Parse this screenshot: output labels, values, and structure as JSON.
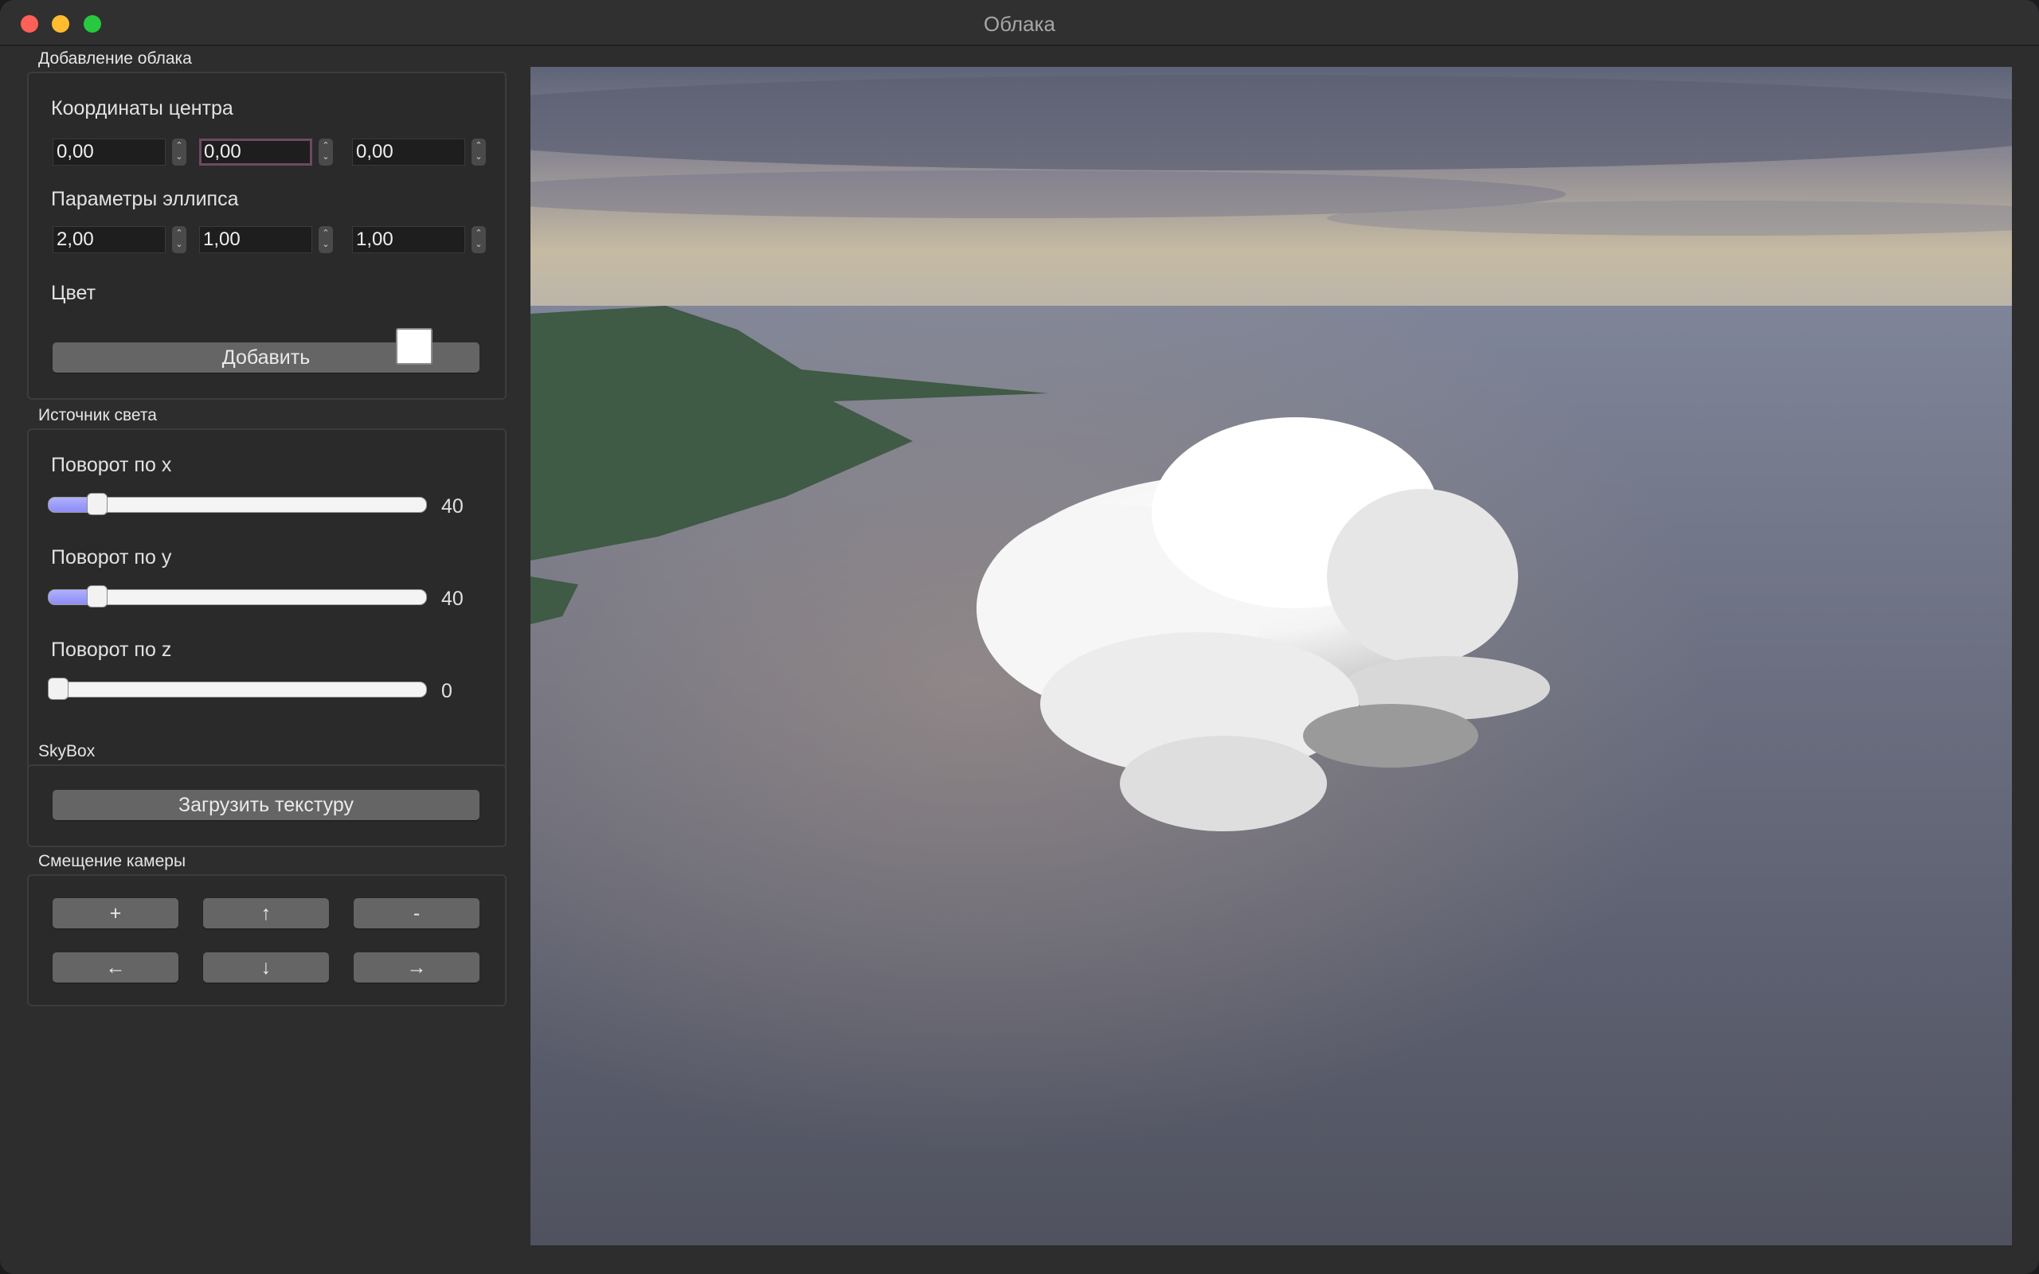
{
  "window": {
    "title": "Облака"
  },
  "cloud_group": {
    "title": "Добавление облака",
    "center_label": "Координаты центра",
    "center_values": [
      "0,00",
      "0,00",
      "0,00"
    ],
    "ellipse_label": "Параметры эллипса",
    "ellipse_values": [
      "2,00",
      "1,00",
      "1,00"
    ],
    "color_label": "Цвет",
    "color_value": "#ffffff",
    "add_button": "Добавить"
  },
  "light_group": {
    "title": "Источник света",
    "sliders": [
      {
        "label": "Поворот по x",
        "value": "40",
        "fraction": 0.11
      },
      {
        "label": "Поворот по y",
        "value": "40",
        "fraction": 0.11
      },
      {
        "label": "Поворот по z",
        "value": "0",
        "fraction": 0.0
      }
    ]
  },
  "skybox_group": {
    "title": "SkyBox",
    "load_button": "Загрузить текстуру"
  },
  "camera_group": {
    "title": "Смещение камеры",
    "buttons": [
      "+",
      "↑",
      "-",
      "←",
      "↓",
      "→"
    ]
  },
  "colors": {
    "slider_fill": "#8c8cf5",
    "focus_border": "#6d4a61",
    "close": "#fe5f57",
    "minimize": "#febc2e",
    "maximize": "#28c840"
  }
}
